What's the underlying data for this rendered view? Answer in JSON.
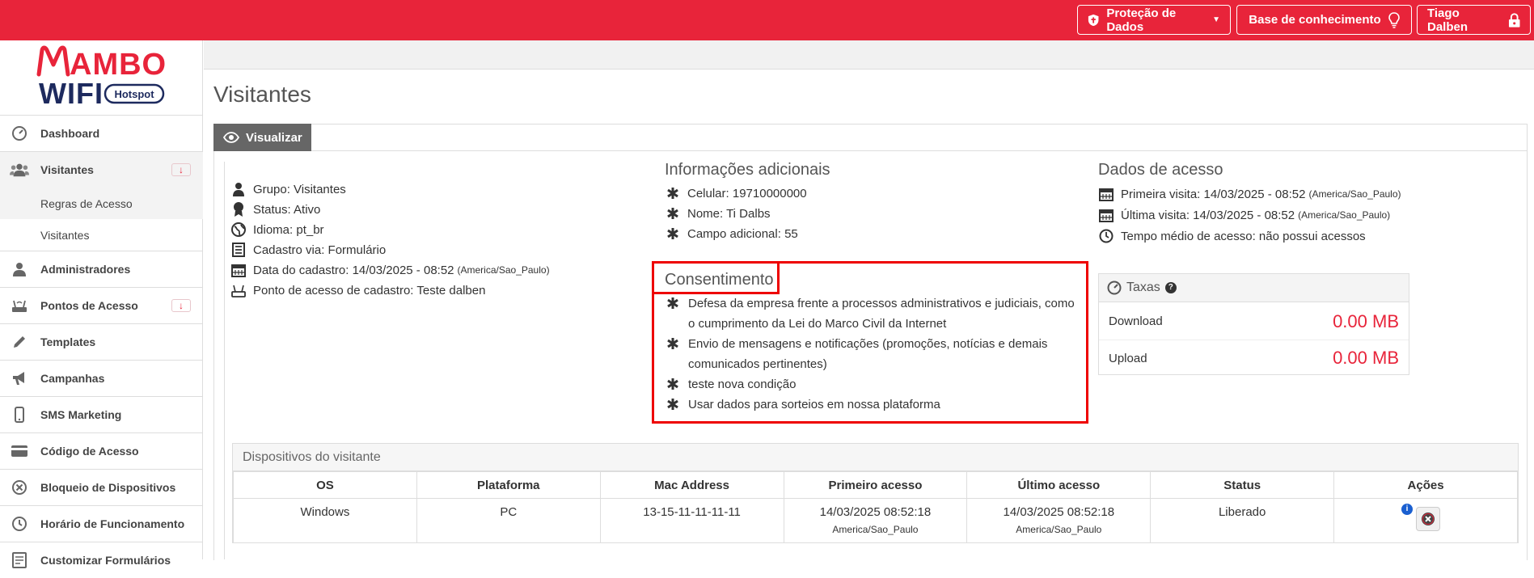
{
  "topbar": {
    "data_protection": "Proteção de Dados",
    "knowledge_base": "Base de conhecimento",
    "user": "Tiago Dalben"
  },
  "brand": {
    "line1": "AMBO",
    "line2": "WIFI",
    "badge": "Hotspot"
  },
  "sidebar": {
    "items": [
      {
        "label": "Dashboard",
        "icon": "dashboard-icon"
      },
      {
        "label": "Visitantes",
        "icon": "users-icon",
        "arrow": "↓"
      },
      {
        "label": "Administradores",
        "icon": "user-icon"
      },
      {
        "label": "Pontos de Acesso",
        "icon": "router-icon",
        "arrow": "↓"
      },
      {
        "label": "Templates",
        "icon": "pencil-icon"
      },
      {
        "label": "Campanhas",
        "icon": "megaphone-icon"
      },
      {
        "label": "SMS Marketing",
        "icon": "phone-icon"
      },
      {
        "label": "Código de Acesso",
        "icon": "card-icon"
      },
      {
        "label": "Bloqueio de Dispositivos",
        "icon": "block-icon"
      },
      {
        "label": "Horário de Funcionamento",
        "icon": "clock-icon"
      },
      {
        "label": "Customizar Formulários",
        "icon": "form-icon"
      }
    ],
    "subitems": [
      "Regras de Acesso",
      "Visitantes"
    ]
  },
  "page": {
    "title": "Visitantes",
    "tab": "Visualizar"
  },
  "visitor": {
    "group": "Grupo: Visitantes",
    "status": "Status: Ativo",
    "language": "Idioma: pt_br",
    "registration": "Cadastro via: Formulário",
    "date": "Data do cadastro: 14/03/2025 - 08:52",
    "date_tz": "(America/Sao_Paulo)",
    "access_point": "Ponto de acesso de cadastro: Teste dalben"
  },
  "additional": {
    "title": "Informações adicionais",
    "phone": "Celular: 19710000000",
    "name": "Nome: Ti Dalbs",
    "extra": "Campo adicional: 55"
  },
  "consent": {
    "title": "Consentimento",
    "items": [
      "Defesa da empresa frente a processos administrativos e judiciais, como o cumprimento da Lei do Marco Civil da Internet",
      "Envio de mensagens e notificações (promoções, notícias e demais comunicados pertinentes)",
      "teste nova condição",
      "Usar dados para sorteios em nossa plataforma"
    ]
  },
  "access": {
    "title": "Dados de acesso",
    "first": "Primeira visita: 14/03/2025 - 08:52",
    "last": "Última visita: 14/03/2025 - 08:52",
    "tz": "(America/Sao_Paulo)",
    "avg": "Tempo médio de acesso: não possui acessos"
  },
  "taxas": {
    "title": "Taxas",
    "download_label": "Download",
    "download_value": "0.00 MB",
    "upload_label": "Upload",
    "upload_value": "0.00 MB"
  },
  "devices": {
    "title": "Dispositivos do visitante",
    "columns": [
      "OS",
      "Plataforma",
      "Mac Address",
      "Primeiro acesso",
      "Último acesso",
      "Status",
      "Ações"
    ],
    "rows": [
      {
        "os": "Windows",
        "platform": "PC",
        "mac": "13-15-11-11-11-11",
        "first": "14/03/2025 08:52:18",
        "first_tz": "America/Sao_Paulo",
        "last": "14/03/2025 08:52:18",
        "last_tz": "America/Sao_Paulo",
        "status": "Liberado"
      }
    ]
  },
  "colors": {
    "brand_red": "#e8243a",
    "status_green": "#2a9a2a",
    "highlight_red": "#e00000",
    "logo_navy": "#1d2a5e"
  }
}
